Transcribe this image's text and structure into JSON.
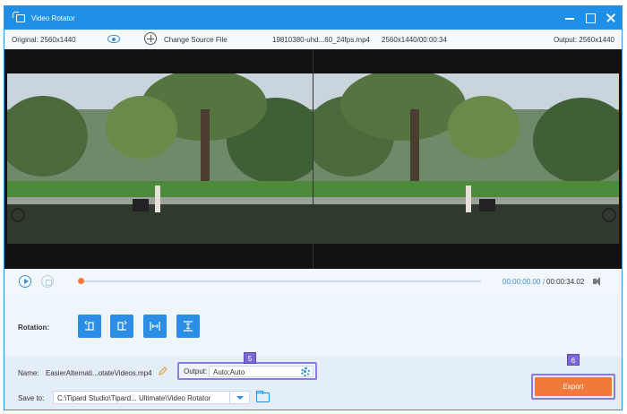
{
  "window": {
    "title": "Video Rotator"
  },
  "info": {
    "original": "Original: 2560x1440",
    "change_source": "Change Source File",
    "filename": "19810380-uhd...60_24fps.mp4",
    "resolution_duration": "2560x1440/00:00:34",
    "output": "Output: 2560x1440"
  },
  "playback": {
    "current_time": "00:00:00.00",
    "separator": "/",
    "total_time": "00:00:34.02",
    "progress": 0.0
  },
  "rotation": {
    "label": "Rotation:",
    "buttons": [
      "rotate-left",
      "rotate-right",
      "flip-horizontal",
      "flip-vertical"
    ]
  },
  "bottom": {
    "name_label": "Name:",
    "name_value": "EasierAlternati...otateVideos.mp4",
    "output_label": "Output:",
    "output_value": "Auto;Auto",
    "save_label": "Save to:",
    "save_value": "C:\\Tipard Studio\\Tipard... Ultimate\\Video Rotator",
    "export_label": "Export",
    "badge_output": "5",
    "badge_export": "6"
  },
  "colors": {
    "accent": "#1f8ee6",
    "export": "#f07a3a",
    "highlight": "#8c7be0"
  }
}
